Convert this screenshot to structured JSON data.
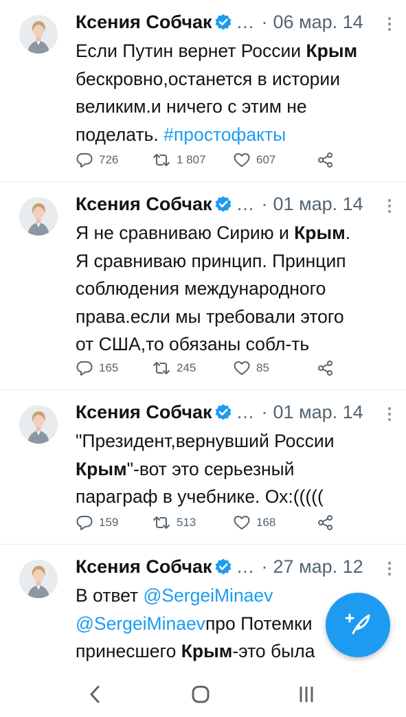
{
  "tweets": [
    {
      "author": "Ксения Собчак",
      "ellipsis": "…",
      "date": "06 мар. 14",
      "lines": [
        [
          {
            "t": "Если Путин вернет России "
          },
          {
            "t": "Крым",
            "b": true
          }
        ],
        [
          {
            "t": "бескровно,останется в истории"
          }
        ],
        [
          {
            "t": "великим.и ничего с этим не"
          }
        ],
        [
          {
            "t": "поделать. "
          },
          {
            "t": "#простофакты",
            "link": true
          }
        ]
      ],
      "replies": "726",
      "retweets": "1 807",
      "likes": "607"
    },
    {
      "author": "Ксения Собчак",
      "ellipsis": "…",
      "date": "01 мар. 14",
      "lines": [
        [
          {
            "t": "Я не сравниваю Сирию и "
          },
          {
            "t": "Крым",
            "b": true
          },
          {
            "t": "."
          }
        ],
        [
          {
            "t": "Я сравниваю принцип. Принцип"
          }
        ],
        [
          {
            "t": "соблюдения международного"
          }
        ],
        [
          {
            "t": "права.если мы требовали этого"
          }
        ],
        [
          {
            "t": "от США,то обязаны собл-ть"
          }
        ]
      ],
      "replies": "165",
      "retweets": "245",
      "likes": "85"
    },
    {
      "author": "Ксения Собчак",
      "ellipsis": "…",
      "date": "01 мар. 14",
      "lines": [
        [
          {
            "t": "\"Президент,вернувший России"
          }
        ],
        [
          {
            "t": "Крым",
            "b": true
          },
          {
            "t": "\"-вот это серьезный"
          }
        ],
        [
          {
            "t": "параграф в учебнике. Ох:((((("
          }
        ]
      ],
      "replies": "159",
      "retweets": "513",
      "likes": "168"
    },
    {
      "author": "Ксения Собчак",
      "ellipsis": "…",
      "date": "27 мар. 12",
      "lines": [
        [
          {
            "t": "В ответ "
          },
          {
            "t": "@SergeiMinaev",
            "link": true
          }
        ],
        [
          {
            "t": "@SergeiMinaev",
            "link": true
          },
          {
            "t": "про Потемки"
          }
        ],
        [
          {
            "t": "принесшего "
          },
          {
            "t": "Крым",
            "b": true
          },
          {
            "t": "-это  была"
          }
        ]
      ]
    }
  ],
  "icons": {
    "verified": "verified-badge-icon",
    "reply": "reply-icon",
    "retweet": "retweet-icon",
    "like": "heart-icon",
    "share": "share-icon",
    "compose": "compose-tweet-icon",
    "nav_back": "nav-back-icon",
    "nav_home": "nav-home-icon",
    "nav_recent": "nav-recent-apps-icon"
  },
  "colors": {
    "accent": "#1d9bf0",
    "text": "#0f1419",
    "secondary": "#536471",
    "divider": "#e6ecf0"
  }
}
